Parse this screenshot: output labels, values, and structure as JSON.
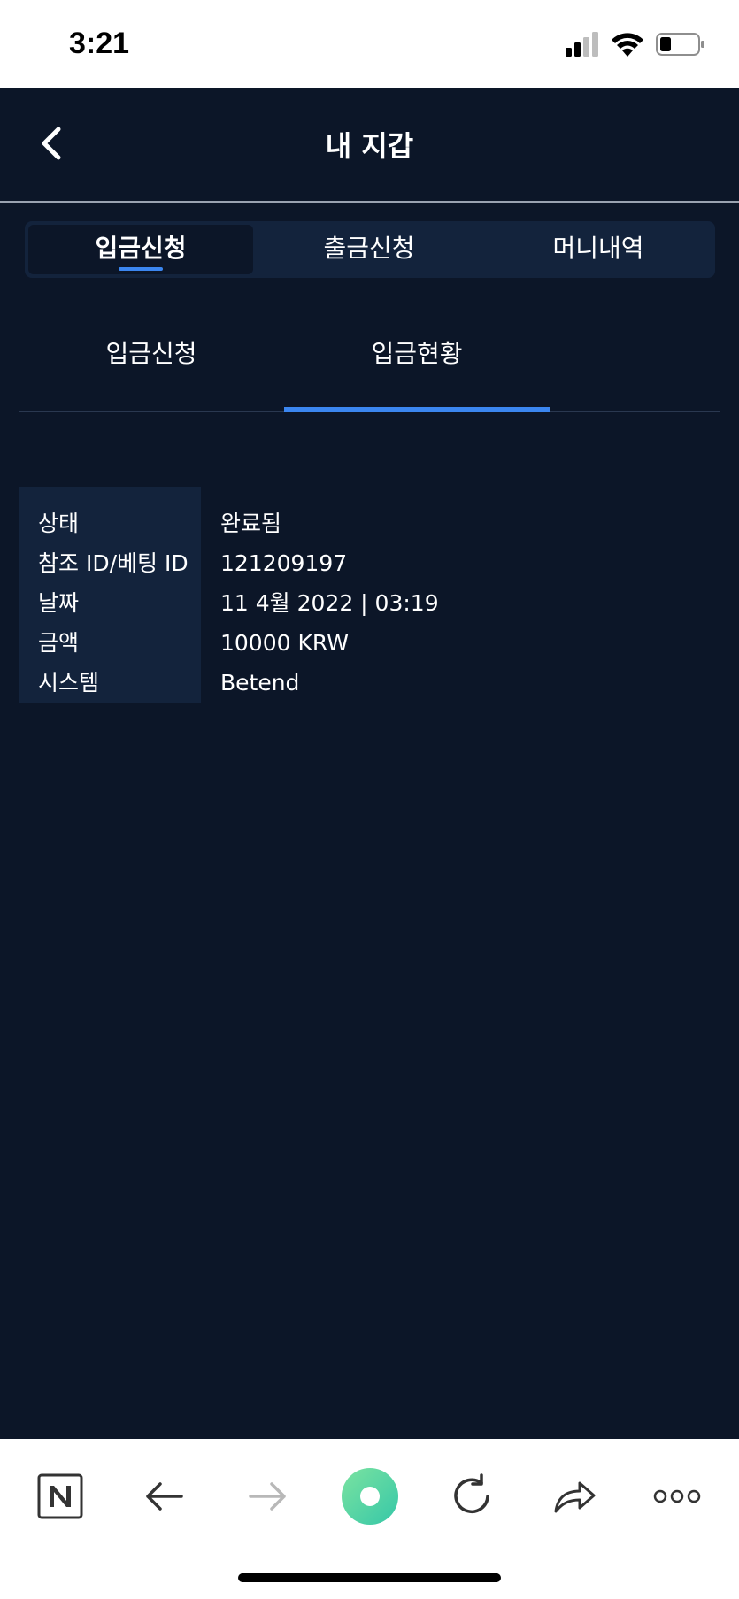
{
  "status_bar": {
    "time": "3:21"
  },
  "header": {
    "title": "내 지갑"
  },
  "tabs": [
    {
      "label": "입금신청",
      "active": true
    },
    {
      "label": "출금신청",
      "active": false
    },
    {
      "label": "머니내역",
      "active": false
    }
  ],
  "subtabs": [
    {
      "label": "입금신청",
      "active": false
    },
    {
      "label": "입금현황",
      "active": true
    }
  ],
  "details": [
    {
      "label": "상태",
      "value": "완료됨"
    },
    {
      "label": "참조 ID/베팅 ID",
      "value": "121209197"
    },
    {
      "label": "날짜",
      "value": "11 4월 2022 | 03:19"
    },
    {
      "label": "금액",
      "value": "10000 KRW"
    },
    {
      "label": "시스템",
      "value": "Betend"
    }
  ],
  "colors": {
    "background": "#0c1628",
    "panel": "#13233c",
    "accent": "#3b86f0"
  },
  "bottom_bar": {
    "icons": [
      "naver-n-icon",
      "back-arrow-icon",
      "forward-arrow-icon",
      "green-circle-icon",
      "refresh-icon",
      "share-icon",
      "more-icon"
    ]
  }
}
